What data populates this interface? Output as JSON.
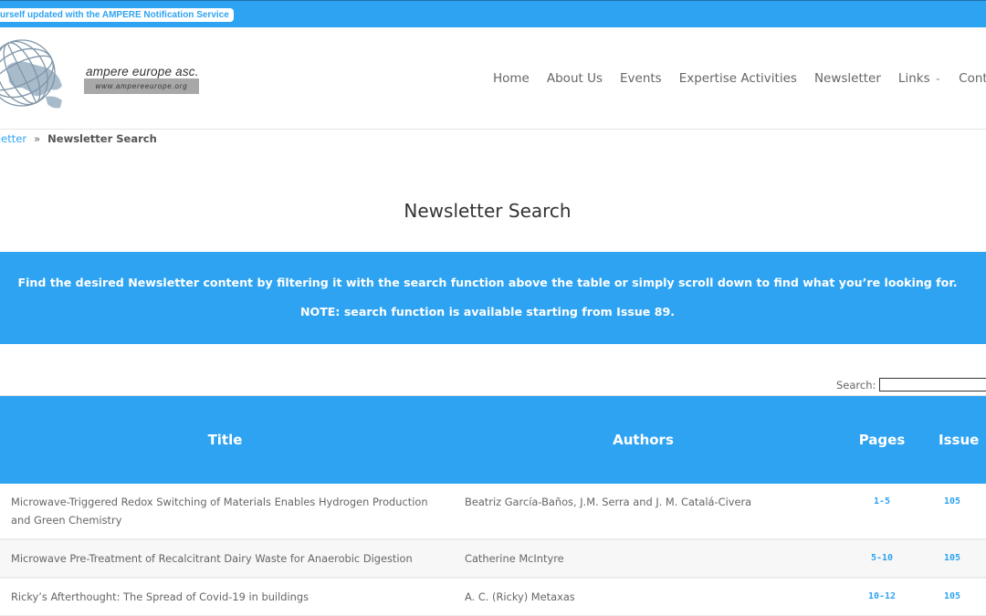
{
  "top_bar": {
    "notification_text": "Keep yourself updated with the AMPERE Notification Service",
    "visible_text": "urself updated with the AMPERE Notification Service"
  },
  "logo": {
    "icon": "globe-icon",
    "name": "ampere europe asc.",
    "url_text": "www.ampereeurope.org"
  },
  "nav": {
    "items": [
      {
        "label": "Home"
      },
      {
        "label": "About Us"
      },
      {
        "label": "Events"
      },
      {
        "label": "Expertise Activities"
      },
      {
        "label": "Newsletter"
      },
      {
        "label": "Links",
        "has_dropdown": true,
        "chevron": "⌄"
      },
      {
        "label": "Conta"
      }
    ]
  },
  "breadcrumb": {
    "parent": "sletter",
    "separator": "»",
    "current": "Newsletter Search"
  },
  "page": {
    "title": "Newsletter Search"
  },
  "info_band": {
    "line1": "Find the desired Newsletter content by filtering it with the search function above the table or simply scroll down to find what you’re looking for.",
    "line2": "NOTE: search function is available starting from Issue 89."
  },
  "search": {
    "label": "Search:",
    "value": ""
  },
  "table": {
    "columns": [
      "Title",
      "Authors",
      "Pages",
      "Issue"
    ],
    "rows": [
      {
        "title": "Microwave-Triggered Redox Switching of Materials Enables Hydrogen Production and Green Chemistry",
        "authors": "Beatriz García-Baños, J.M. Serra and J. M. Catalá-Civera",
        "pages": "1-5",
        "issue": "105"
      },
      {
        "title": "Microwave Pre-Treatment of Recalcitrant Dairy Waste for Anaerobic Digestion",
        "authors": "Catherine McIntyre",
        "pages": "5-10",
        "issue": "105"
      },
      {
        "title": "Ricky’s Afterthought: The Spread of Covid-19 in buildings",
        "authors": "A. C. (Ricky) Metaxas",
        "pages": "10-12",
        "issue": "105"
      }
    ]
  },
  "colors": {
    "accent": "#2ea3f2",
    "text": "#666666",
    "heading": "#333333",
    "row_alt": "#f7f7f7"
  }
}
